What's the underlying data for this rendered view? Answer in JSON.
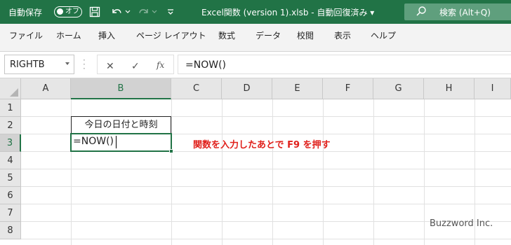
{
  "titlebar": {
    "autosave_label": "自動保存",
    "autosave_state": "オフ",
    "title": "Excel関数 (version 1).xlsb  -  自動回復済み  ▾",
    "search_label": "検索 (Alt+Q)",
    "icons": [
      "save-icon",
      "undo-icon",
      "redo-icon",
      "customize-qat-icon",
      "search-icon"
    ],
    "bg_color": "#217346"
  },
  "menu": {
    "items": [
      "ファイル",
      "ホーム",
      "挿入",
      "ページ レイアウト",
      "数式",
      "データ",
      "校閲",
      "表示",
      "ヘルプ"
    ]
  },
  "formula_bar": {
    "name_box": "RIGHTB",
    "buttons": [
      "✕",
      "✓",
      "fx"
    ],
    "formula": "=NOW()"
  },
  "sheet": {
    "columns": [
      "A",
      "B",
      "C",
      "D",
      "E",
      "F",
      "G",
      "H",
      "I"
    ],
    "selected_column": "B",
    "rows": [
      "1",
      "2",
      "3",
      "4",
      "5",
      "6",
      "7",
      "8"
    ],
    "selected_row": "3",
    "b2_value": "今日の日付と時刻",
    "b3_value": "=NOW()",
    "annotation": "関数を入力したあとで F9 を押す",
    "annotation_color": "#e0201b",
    "watermark": "Buzzword Inc."
  }
}
